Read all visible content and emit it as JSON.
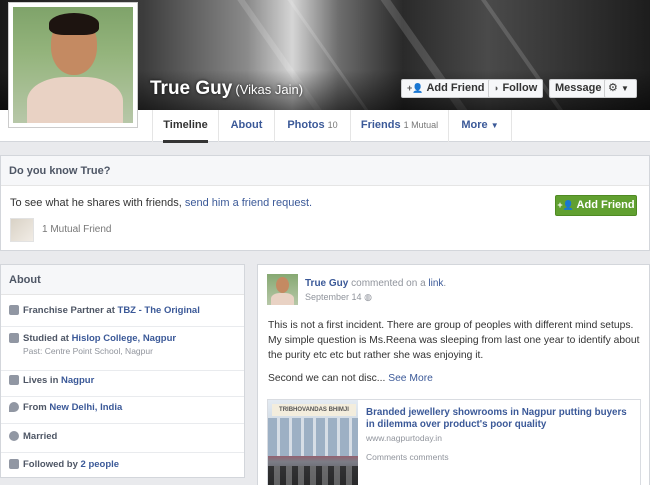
{
  "profile": {
    "name": "True Guy",
    "alternate_name": "(Vikas Jain)"
  },
  "cover_actions": {
    "add_friend": "Add Friend",
    "follow": "Follow",
    "message": "Message"
  },
  "tabs": [
    {
      "label": "Timeline",
      "count": ""
    },
    {
      "label": "About",
      "count": ""
    },
    {
      "label": "Photos",
      "count": "10"
    },
    {
      "label": "Friends",
      "count": "1 Mutual"
    },
    {
      "label": "More",
      "count": ""
    }
  ],
  "know_box": {
    "title": "Do you know True?",
    "text_prefix": "To see what he shares with friends, ",
    "link": "send him a friend request.",
    "mutual": "1 Mutual Friend",
    "button": "Add Friend"
  },
  "about": {
    "title": "About",
    "work_prefix": "Franchise Partner at ",
    "work_place": "TBZ - The Original",
    "edu_prefix": "Studied at ",
    "edu_place": "Hislop College, Nagpur",
    "edu_past": "Past: Centre Point School, Nagpur",
    "lives_prefix": "Lives in ",
    "lives_place": "Nagpur",
    "from_prefix": "From ",
    "from_place": "New Delhi, India",
    "relationship": "Married",
    "followed_prefix": "Followed by ",
    "followed_count": "2 people"
  },
  "post": {
    "author": "True Guy",
    "action": " commented on a ",
    "action_link": "link",
    "action_end": ".",
    "date": "September 14",
    "body": "This is not a first incident. There are group of peoples with different mind setups. My simple question is Ms.Reena was sleeping from last one year to identify about the purity etc etc but rather she was enjoying it.",
    "body2": "Second we can not disc... ",
    "see_more": "See More",
    "share_title": "Branded jewellery showrooms in Nagpur putting buyers in dilemma over product's poor quality",
    "share_url": "www.nagpurtoday.in",
    "share_comments": "Comments comments",
    "share_sign": "TRIBHOVANDAS BHIMJI ZAVERI"
  },
  "colors": {
    "link": "#3b5998",
    "green_button": "#61a030",
    "background": "#e9eaed"
  }
}
